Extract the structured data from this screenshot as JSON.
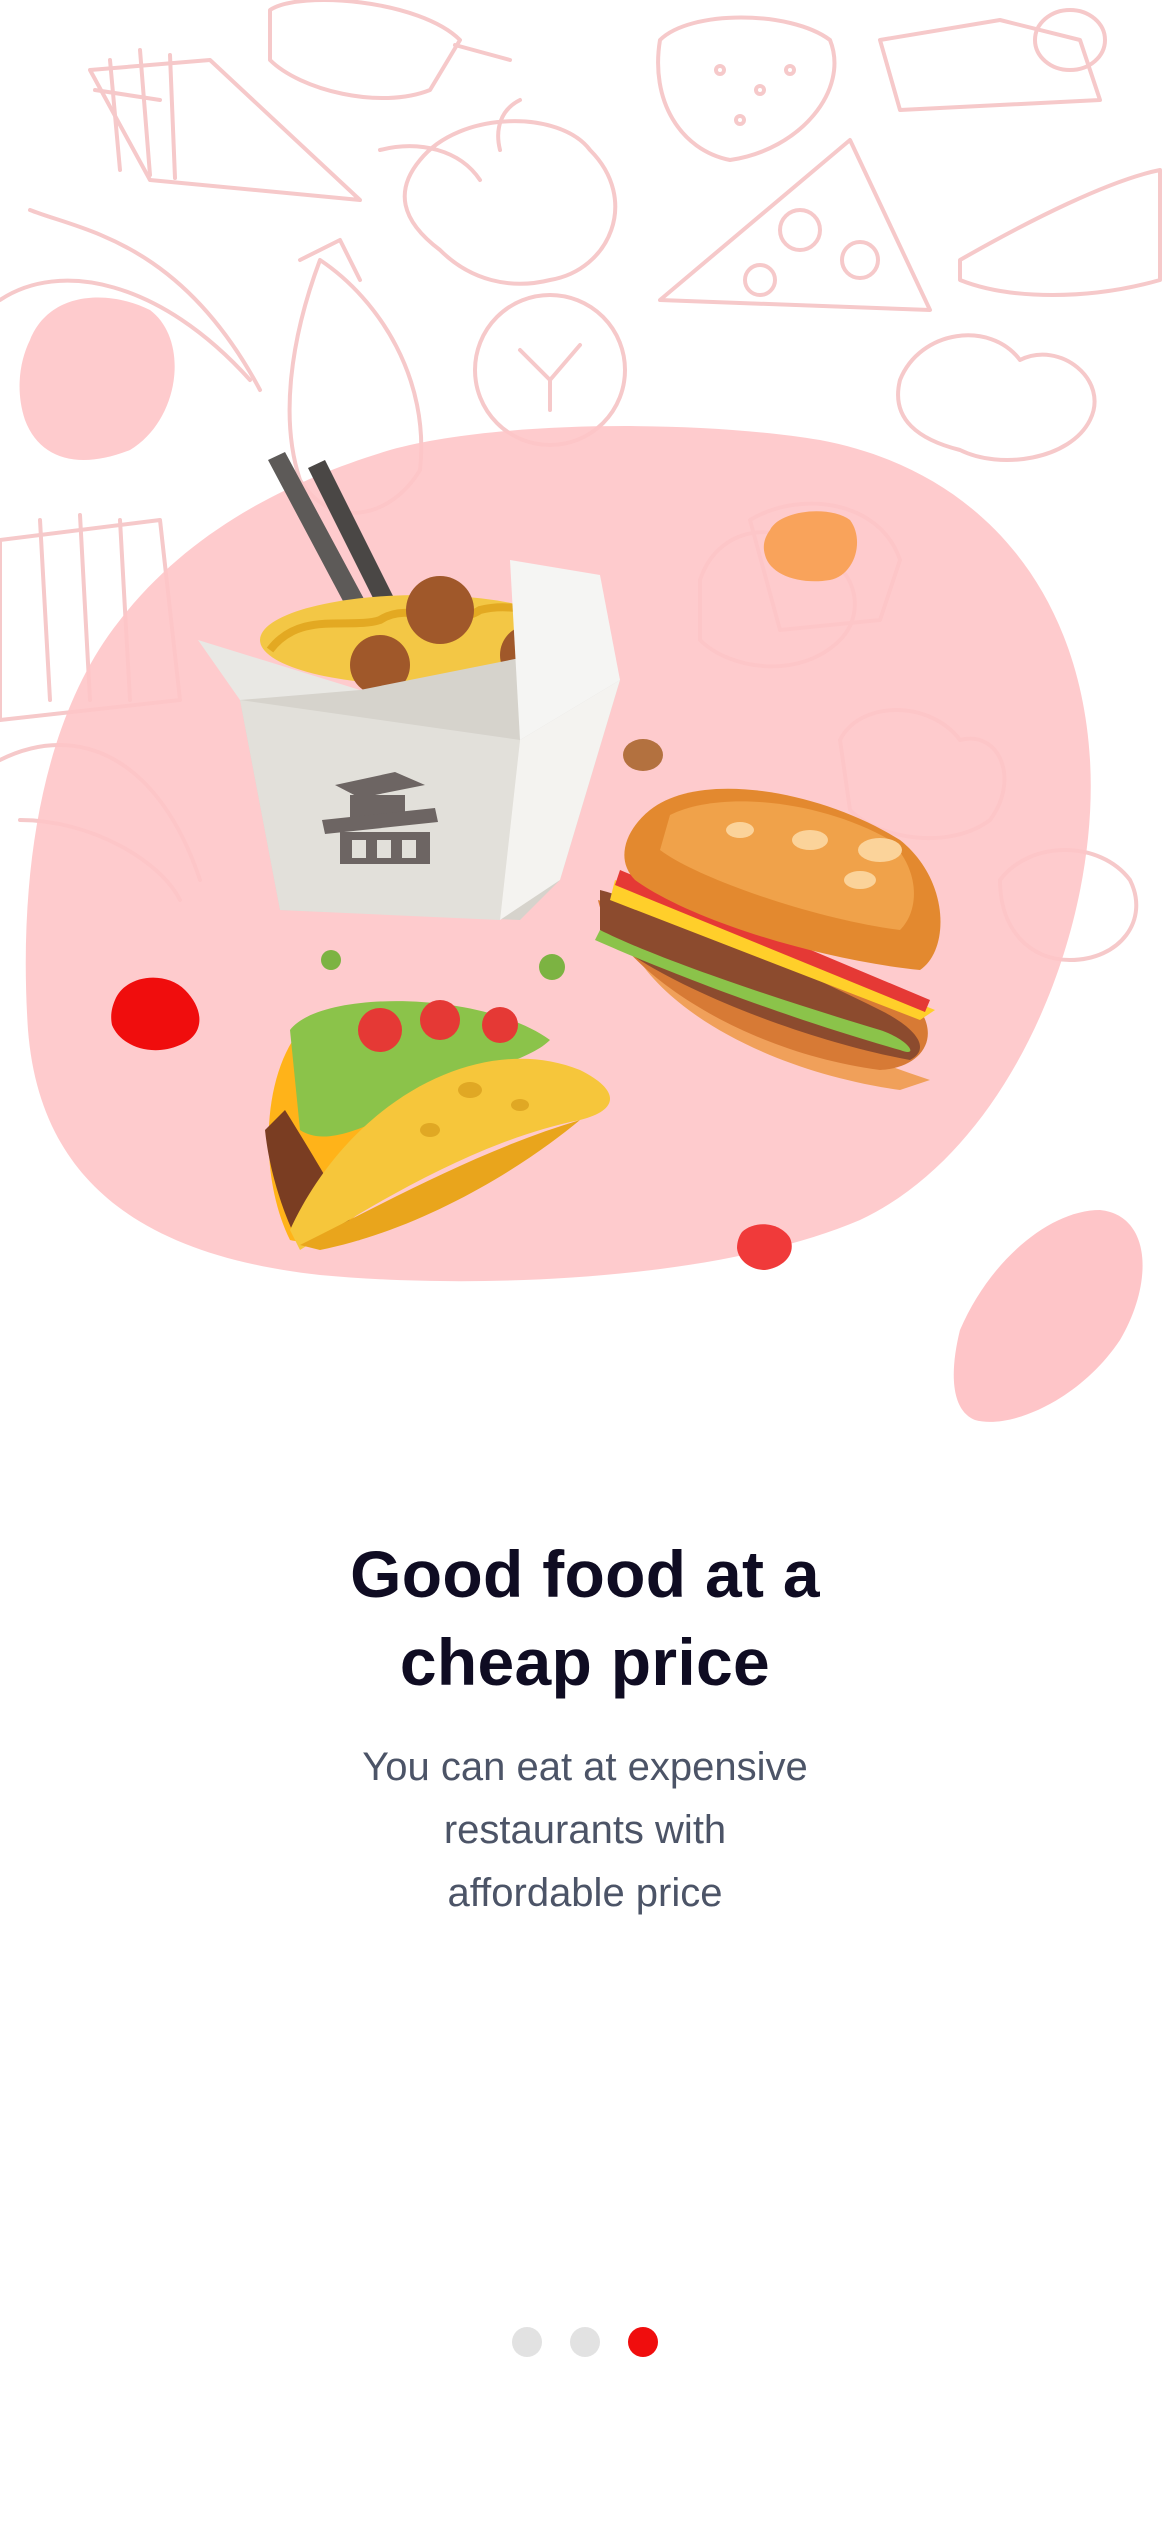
{
  "onboarding": {
    "title": "Good food at a cheap price",
    "subtitle_lines": [
      "You can eat at expensive",
      "restaurants with",
      "affordable price"
    ],
    "pager": {
      "total": 3,
      "active_index": 2
    }
  },
  "illustration": {
    "items": [
      "noodle-box",
      "taco",
      "burger"
    ],
    "background": "food-doodle-pattern"
  },
  "colors": {
    "title": "#0f0c22",
    "subtitle": "#4c5467",
    "accent": "#f00d0d",
    "blob": "#fec5c8",
    "doodle": "#f6c9ca",
    "dot_inactive": "#e2e2e2"
  }
}
